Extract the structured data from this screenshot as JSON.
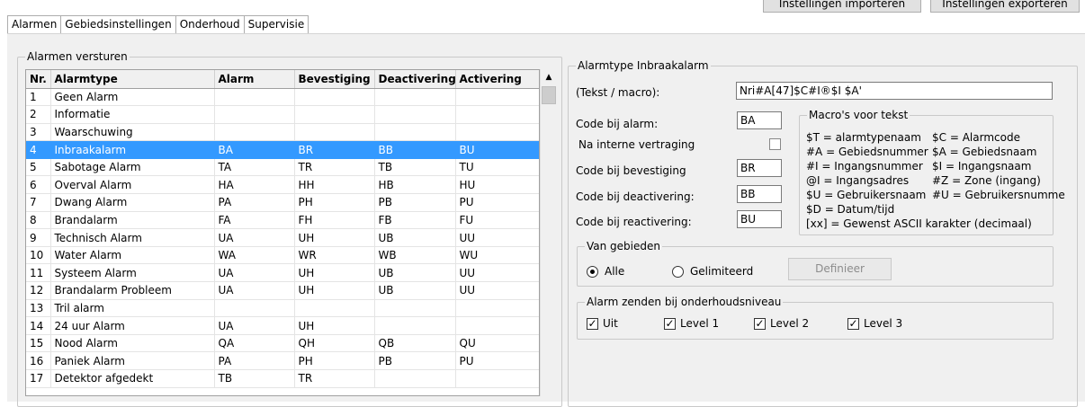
{
  "top_buttons": {
    "import": "Instellingen importeren",
    "export": "Instellingen exporteren"
  },
  "tabs": [
    {
      "label": "Alarmen"
    },
    {
      "label": "Gebiedsinstellingen"
    },
    {
      "label": "Onderhoud"
    },
    {
      "label": "Supervisie"
    }
  ],
  "left_group": {
    "title": "Alarmen versturen",
    "columns": [
      "Nr.",
      "Alarmtype",
      "Alarm",
      "Bevestiging",
      "Deactivering",
      "Activering"
    ],
    "rows": [
      [
        "1",
        "Geen Alarm",
        "",
        "",
        "",
        ""
      ],
      [
        "2",
        "Informatie",
        "",
        "",
        "",
        ""
      ],
      [
        "3",
        "Waarschuwing",
        "",
        "",
        "",
        ""
      ],
      [
        "4",
        "Inbraakalarm",
        "BA",
        "BR",
        "BB",
        "BU"
      ],
      [
        "5",
        "Sabotage Alarm",
        "TA",
        "TR",
        "TB",
        "TU"
      ],
      [
        "6",
        "Overval Alarm",
        "HA",
        "HH",
        "HB",
        "HU"
      ],
      [
        "7",
        "Dwang Alarm",
        "PA",
        "PH",
        "PB",
        "PU"
      ],
      [
        "8",
        "Brandalarm",
        "FA",
        "FH",
        "FB",
        "FU"
      ],
      [
        "9",
        "Technisch Alarm",
        "UA",
        "UH",
        "UB",
        "UU"
      ],
      [
        "10",
        "Water Alarm",
        "WA",
        "WR",
        "WB",
        "WU"
      ],
      [
        "11",
        "Systeem Alarm",
        "UA",
        "UH",
        "UB",
        "UU"
      ],
      [
        "12",
        "Brandalarm Probleem",
        "UA",
        "UH",
        "UB",
        "UU"
      ],
      [
        "13",
        "Tril alarm",
        "",
        "",
        "",
        ""
      ],
      [
        "14",
        "24 uur Alarm",
        "UA",
        "UH",
        "",
        ""
      ],
      [
        "15",
        "Nood Alarm",
        "QA",
        "QH",
        "QB",
        "QU"
      ],
      [
        "16",
        "Paniek Alarm",
        "PA",
        "PH",
        "PB",
        "PU"
      ],
      [
        "17",
        "Detektor afgedekt",
        "TB",
        "TR",
        "",
        ""
      ]
    ],
    "selected_row": 3
  },
  "right_group": {
    "title": "Alarmtype Inbraakalarm",
    "text_macro_label": "(Tekst / macro):",
    "text_macro_value": "Nri#A[47]$C#I®$I $A'",
    "code_alarm_label": "Code bij alarm:",
    "code_alarm_value": "BA",
    "internal_delay_label": "Na interne vertraging",
    "code_confirm_label": "Code bij bevestiging",
    "code_confirm_value": "BR",
    "code_deactivate_label": "Code bij deactivering:",
    "code_deactivate_value": "BB",
    "code_reactivate_label": "Code bij reactivering:",
    "code_reactivate_value": "BU",
    "macros": {
      "title": "Macro's voor tekst",
      "left": [
        "$T = alarmtypenaam",
        "#A = Gebiedsnummer",
        "#I = Ingangsnummer",
        "@I = Ingangsadres",
        "$U = Gebruikersnaam",
        "$D = Datum/tijd",
        "[xx] = Gewenst ASCII karakter (decimaal)"
      ],
      "right": [
        "$C = Alarmcode",
        "$A = Gebiedsnaam",
        "$I = Ingangsnaam",
        "#Z = Zone (ingang)",
        "#U = Gebruikersnumme"
      ]
    },
    "areas": {
      "title": "Van gebieden",
      "all_label": "Alle",
      "limited_label": "Gelimiteerd",
      "define_label": "Definieer"
    },
    "maintenance": {
      "title": "Alarm zenden bij onderhoudsniveau",
      "options": [
        "Uit",
        "Level 1",
        "Level 2",
        "Level 3"
      ]
    }
  }
}
